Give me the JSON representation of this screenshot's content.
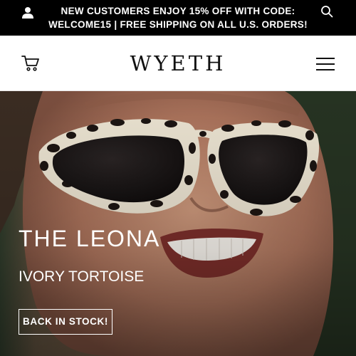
{
  "announcement": {
    "line1": "NEW CUSTOMERS ENJOY 15% OFF WITH CODE:",
    "line2": "WELCOME15 | FREE SHIPPING ON ALL U.S. ORDERS!"
  },
  "header": {
    "logo": "WYETH"
  },
  "hero": {
    "title": "THE LEONA",
    "subtitle": "IVORY TORTOISE",
    "cta_label": "BACK IN STOCK!"
  },
  "icons": {
    "account": "user-icon",
    "search": "search-icon",
    "cart": "cart-icon",
    "menu": "hamburger-menu-icon"
  },
  "colors": {
    "announcement_bg": "#000000",
    "announcement_text": "#ffffff",
    "hero_text": "#ffffff"
  }
}
